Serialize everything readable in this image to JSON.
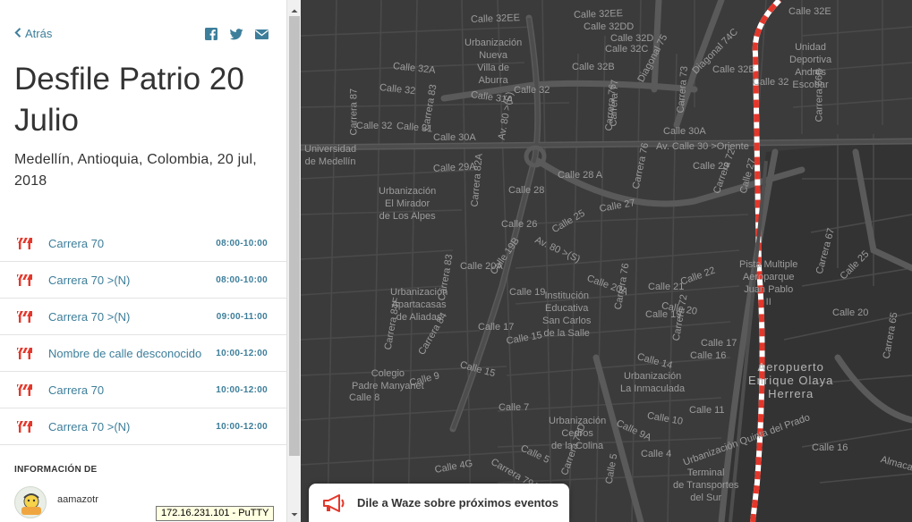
{
  "nav": {
    "back_label": "Atrás"
  },
  "share": [
    {
      "icon": "facebook-icon"
    },
    {
      "icon": "twitter-icon"
    },
    {
      "icon": "email-icon"
    }
  ],
  "event": {
    "title": "Desfile Patrio 20 Julio",
    "location": "Medellín, Antioquia, Colombia, 20 jul, 2018"
  },
  "schedule": [
    {
      "street": "Carrera 70",
      "time": "08:00-10:00"
    },
    {
      "street": "Carrera 70 >(N)",
      "time": "08:00-10:00"
    },
    {
      "street": "Carrera 70 >(N)",
      "time": "09:00-11:00"
    },
    {
      "street": "Nombre de calle desconocido",
      "time": "10:00-12:00"
    },
    {
      "street": "Carrera 70",
      "time": "10:00-12:00"
    },
    {
      "street": "Carrera 70 >(N)",
      "time": "10:00-12:00"
    }
  ],
  "info": {
    "heading": "INFORMACIÓN DE",
    "author": "aamazotr"
  },
  "tooltip": "172.16.231.101 - PuTTY",
  "cta": {
    "label": "Dile a Waze sobre próximos eventos",
    "icon": "megaphone-icon"
  },
  "colors": {
    "accent": "#3d7e9a",
    "route": "#e4372b",
    "map_bg": "#3b3b3b"
  },
  "map_labels": [
    "Calle 32EE",
    "Calle 32EE",
    "Calle 32E",
    "Calle 32DD",
    "Calle 32D",
    "Calle 32C",
    "Calle 32B",
    "Urbanización\nNueva\nVilla de\nAburra",
    "Calle 32A",
    "Calle 32",
    "Calle 31A",
    "Calle 32",
    "Diagonal 75",
    "Diagonal 74C",
    "Calle 32E",
    "Unidad\nDeportiva\nAndrés\nEscobar",
    "Carrera 66B",
    "Calle 32",
    "Calle 32",
    "Calle 31",
    "Carrera 87",
    "Carrera 83",
    "Av. 80 >(S)",
    "Carrera 76",
    "Carrera 77",
    "Carrera 73",
    "Calle 30A",
    "Calle 30A",
    "Universidad\nde Medellín",
    "Av. Calle 30 >Oriente",
    "Calle 29A",
    "Calle 29",
    "Calle 28 A",
    "Calle 28",
    "Urbanización\nEl Mirador\nde Los Alpes",
    "Carrera 82A",
    "Calle 27",
    "Carrera 76",
    "Carrera 72",
    "Calle 27",
    "Calle 26",
    "Av. 80 >(S)",
    "Calle 25",
    "Calle 20A",
    "Calle 19B",
    "Calle 19",
    "Institución\nEducativa\nSan Carlos\nde la Salle",
    "Calle 20A",
    "Carrera 76",
    "Calle 21",
    "Calle 22",
    "Calle 20",
    "Calle 19",
    "Pista Multiple\nAeroparque\nJuan Pablo\nII",
    "Carrera 67",
    "Calle 25",
    "Urbanización\nApartacasas\nde Aliadas",
    "Carrera 83",
    "Calle 17",
    "Calle 15",
    "Carrera 84F",
    "Carrera 84",
    "Calle 15",
    "Calle 14",
    "Carrera 72",
    "Calle 17",
    "Calle 16",
    "Calle 20",
    "Aeropuerto\nEnrique Olaya\nHerrera",
    "Carrera 65",
    "Colegio\nPadre Manyanet",
    "Calle 9",
    "Calle 8",
    "Urbanización\nLa Inmaculada",
    "Calle 10",
    "Calle 11",
    "Calle 7",
    "Calle 9A",
    "Urbanización\nCedros\nde la Colina",
    "Calle 5",
    "Calle 4G",
    "Carrera 79A",
    "Carrera 75D",
    "Calle 5",
    "Calle 4",
    "Urbanización\nQuinta\ndel Prado",
    "Terminal\nde Transportes\ndel Sur",
    "Calle 16",
    "Almaca\nGenera\nEPM"
  ]
}
